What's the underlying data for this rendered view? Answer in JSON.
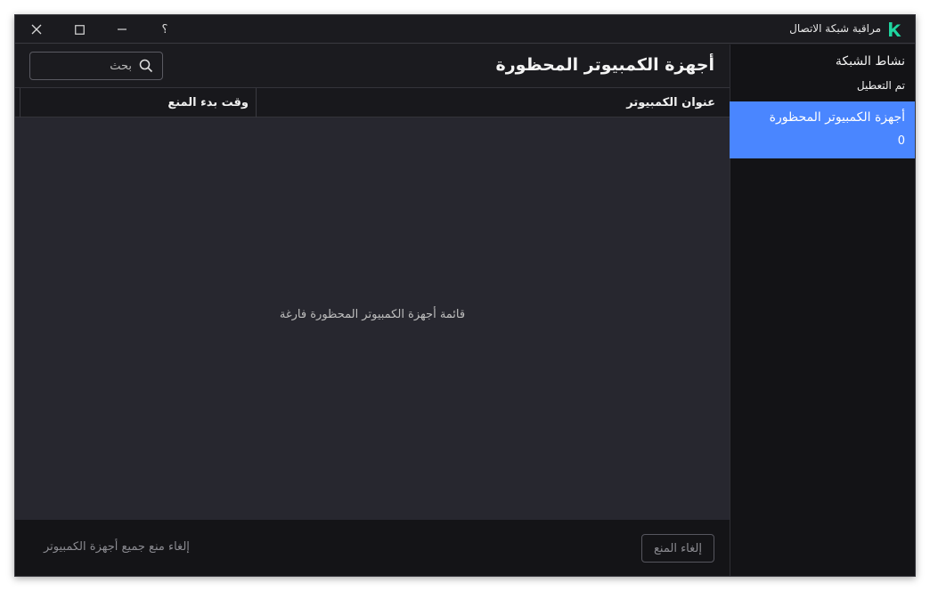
{
  "window": {
    "title": "مراقبة شبكة الاتصال",
    "help_label": "؟",
    "brand_color": "#1fd6a0",
    "accent_color": "#4a86ff"
  },
  "sidebar": {
    "items": [
      {
        "label": "نشاط الشبكة",
        "sublabel": "تم التعطيل",
        "selected": false
      },
      {
        "label": "أجهزة الكمبيوتر المحظورة",
        "sublabel": "0",
        "selected": true
      }
    ]
  },
  "main": {
    "title": "أجهزة الكمبيوتر المحظورة",
    "search": {
      "placeholder": "بحث",
      "value": ""
    },
    "table": {
      "columns": [
        "عنوان الكمبيوتر",
        "وقت بدء المنع"
      ],
      "rows": [],
      "empty_message": "قائمة أجهزة الكمبيوتر المحظورة فارغة"
    },
    "footer": {
      "unblock_label": "إلغاء المنع",
      "unblock_all_label": "إلغاء منع جميع أجهزة الكمبيوتر"
    }
  }
}
